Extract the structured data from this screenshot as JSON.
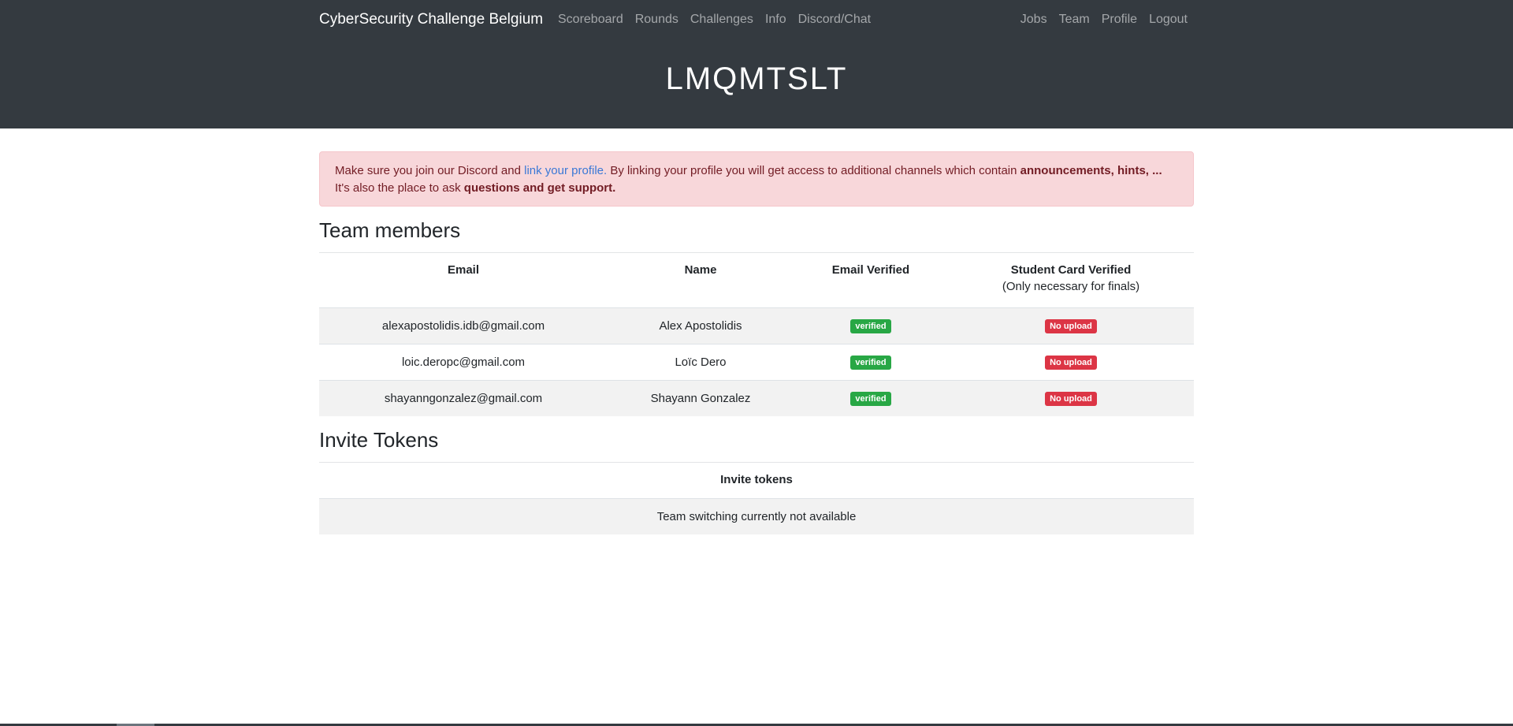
{
  "nav": {
    "brand": "CyberSecurity Challenge Belgium",
    "left_links": [
      "Scoreboard",
      "Rounds",
      "Challenges",
      "Info",
      "Discord/Chat"
    ],
    "right_links": [
      "Jobs",
      "Team",
      "Profile",
      "Logout"
    ]
  },
  "team_name": "LMQMTSLT",
  "alert": {
    "text_1": "Make sure you join our Discord and ",
    "link": "link your profile.",
    "text_2": " By linking your profile you will get access to additional channels which contain ",
    "bold_1": "announcements, hints, ...",
    "text_3": "It's also the place to ask ",
    "bold_2": "questions and get support."
  },
  "team_members": {
    "title": "Team members",
    "headers": {
      "email": "Email",
      "name": "Name",
      "email_verified": "Email Verified",
      "student_card": "Student Card Verified",
      "student_card_note": "(Only necessary for finals)"
    },
    "rows": [
      {
        "email": "alexapostolidis.idb@gmail.com",
        "name": "Alex Apostolidis",
        "email_verified": "verified",
        "student_card": "No upload"
      },
      {
        "email": "loic.deropc@gmail.com",
        "name": "Loïc Dero",
        "email_verified": "verified",
        "student_card": "No upload"
      },
      {
        "email": "shayanngonzalez@gmail.com",
        "name": "Shayann Gonzalez",
        "email_verified": "verified",
        "student_card": "No upload"
      }
    ]
  },
  "invite_tokens": {
    "title": "Invite Tokens",
    "header": "Invite tokens",
    "message": "Team switching currently not available"
  },
  "colors": {
    "header_bg": "#343a40",
    "alert_bg": "#f8d7da",
    "alert_text": "#721c24",
    "link": "#3a78d6",
    "badge_success": "#28a745",
    "badge_danger": "#dc3545"
  }
}
